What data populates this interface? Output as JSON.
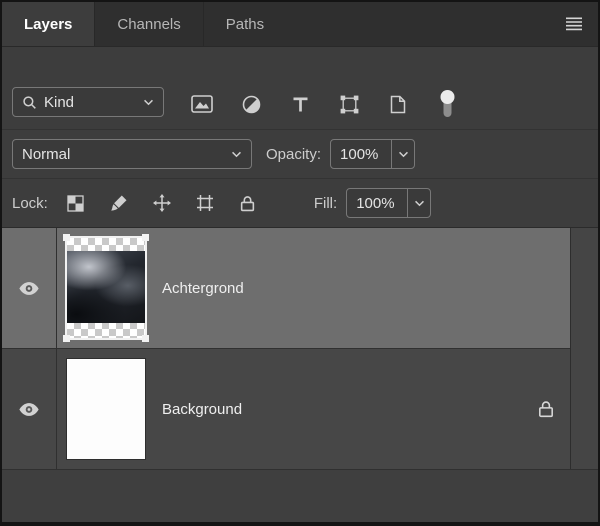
{
  "colors": {
    "panel_bg": "#3d3d3d",
    "tab_bar_bg": "#2f2f2f",
    "selected_layer_bg": "#6e6e6e",
    "layer_row_bg": "#474747",
    "text": "#e4e4e4"
  },
  "tabs": [
    {
      "label": "Layers",
      "active": true
    },
    {
      "label": "Channels",
      "active": false
    },
    {
      "label": "Paths",
      "active": false
    }
  ],
  "panel_menu_icon": "panel-menu-icon",
  "filter_bar": {
    "kind_label": "Kind",
    "search_icon": "search-icon",
    "filter_icons": [
      "pixel-filter-icon",
      "adjustment-filter-icon",
      "type-filter-icon",
      "shape-filter-icon",
      "smart-object-filter-icon"
    ],
    "toggle_icon": "filter-toggle"
  },
  "blend_bar": {
    "blend_mode": "Normal",
    "opacity_label": "Opacity:",
    "opacity_value": "100%"
  },
  "lock_bar": {
    "lock_label": "Lock:",
    "lock_icons": [
      "lock-transparency-icon",
      "lock-pixels-icon",
      "lock-position-icon",
      "lock-artboard-icon",
      "lock-all-icon"
    ],
    "fill_label": "Fill:",
    "fill_value": "100%"
  },
  "layers": [
    {
      "name": "Achtergrond",
      "selected": true,
      "visible": true,
      "locked": false,
      "thumbnail": "storm-clouds-on-transparency"
    },
    {
      "name": "Background",
      "selected": false,
      "visible": true,
      "locked": true,
      "thumbnail": "solid-white"
    }
  ]
}
